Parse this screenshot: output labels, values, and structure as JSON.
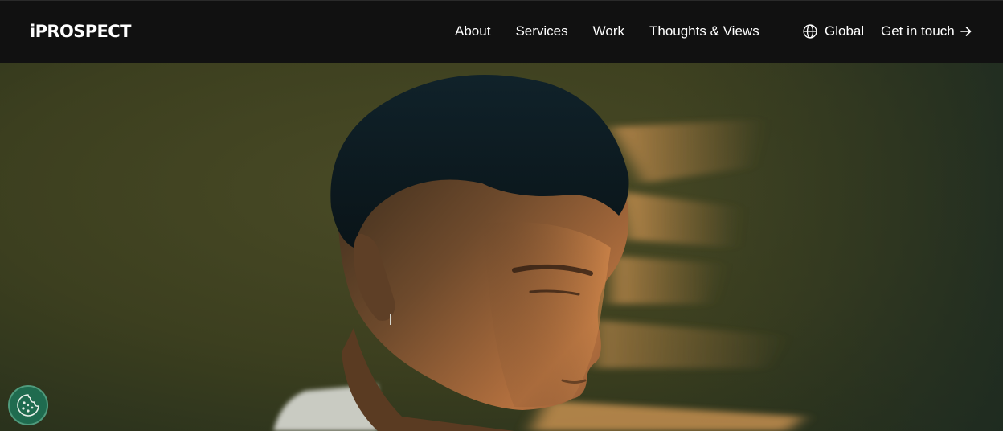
{
  "header": {
    "logo_text": "iPROSPECT",
    "nav": [
      {
        "label": "About"
      },
      {
        "label": "Services"
      },
      {
        "label": "Work"
      },
      {
        "label": "Thoughts & Views"
      }
    ],
    "region_label": "Global",
    "region_icon": "globe-icon",
    "cta_label": "Get in touch",
    "cta_icon": "arrow-right-icon"
  },
  "hero": {
    "image": "portrait-photo",
    "dominant_colors": [
      "#3b3f1f",
      "#1d2a2a",
      "#d9974f",
      "#0e1a1f"
    ]
  },
  "cookie_button": {
    "icon": "cookie-icon",
    "color": "#1f6b4f"
  }
}
